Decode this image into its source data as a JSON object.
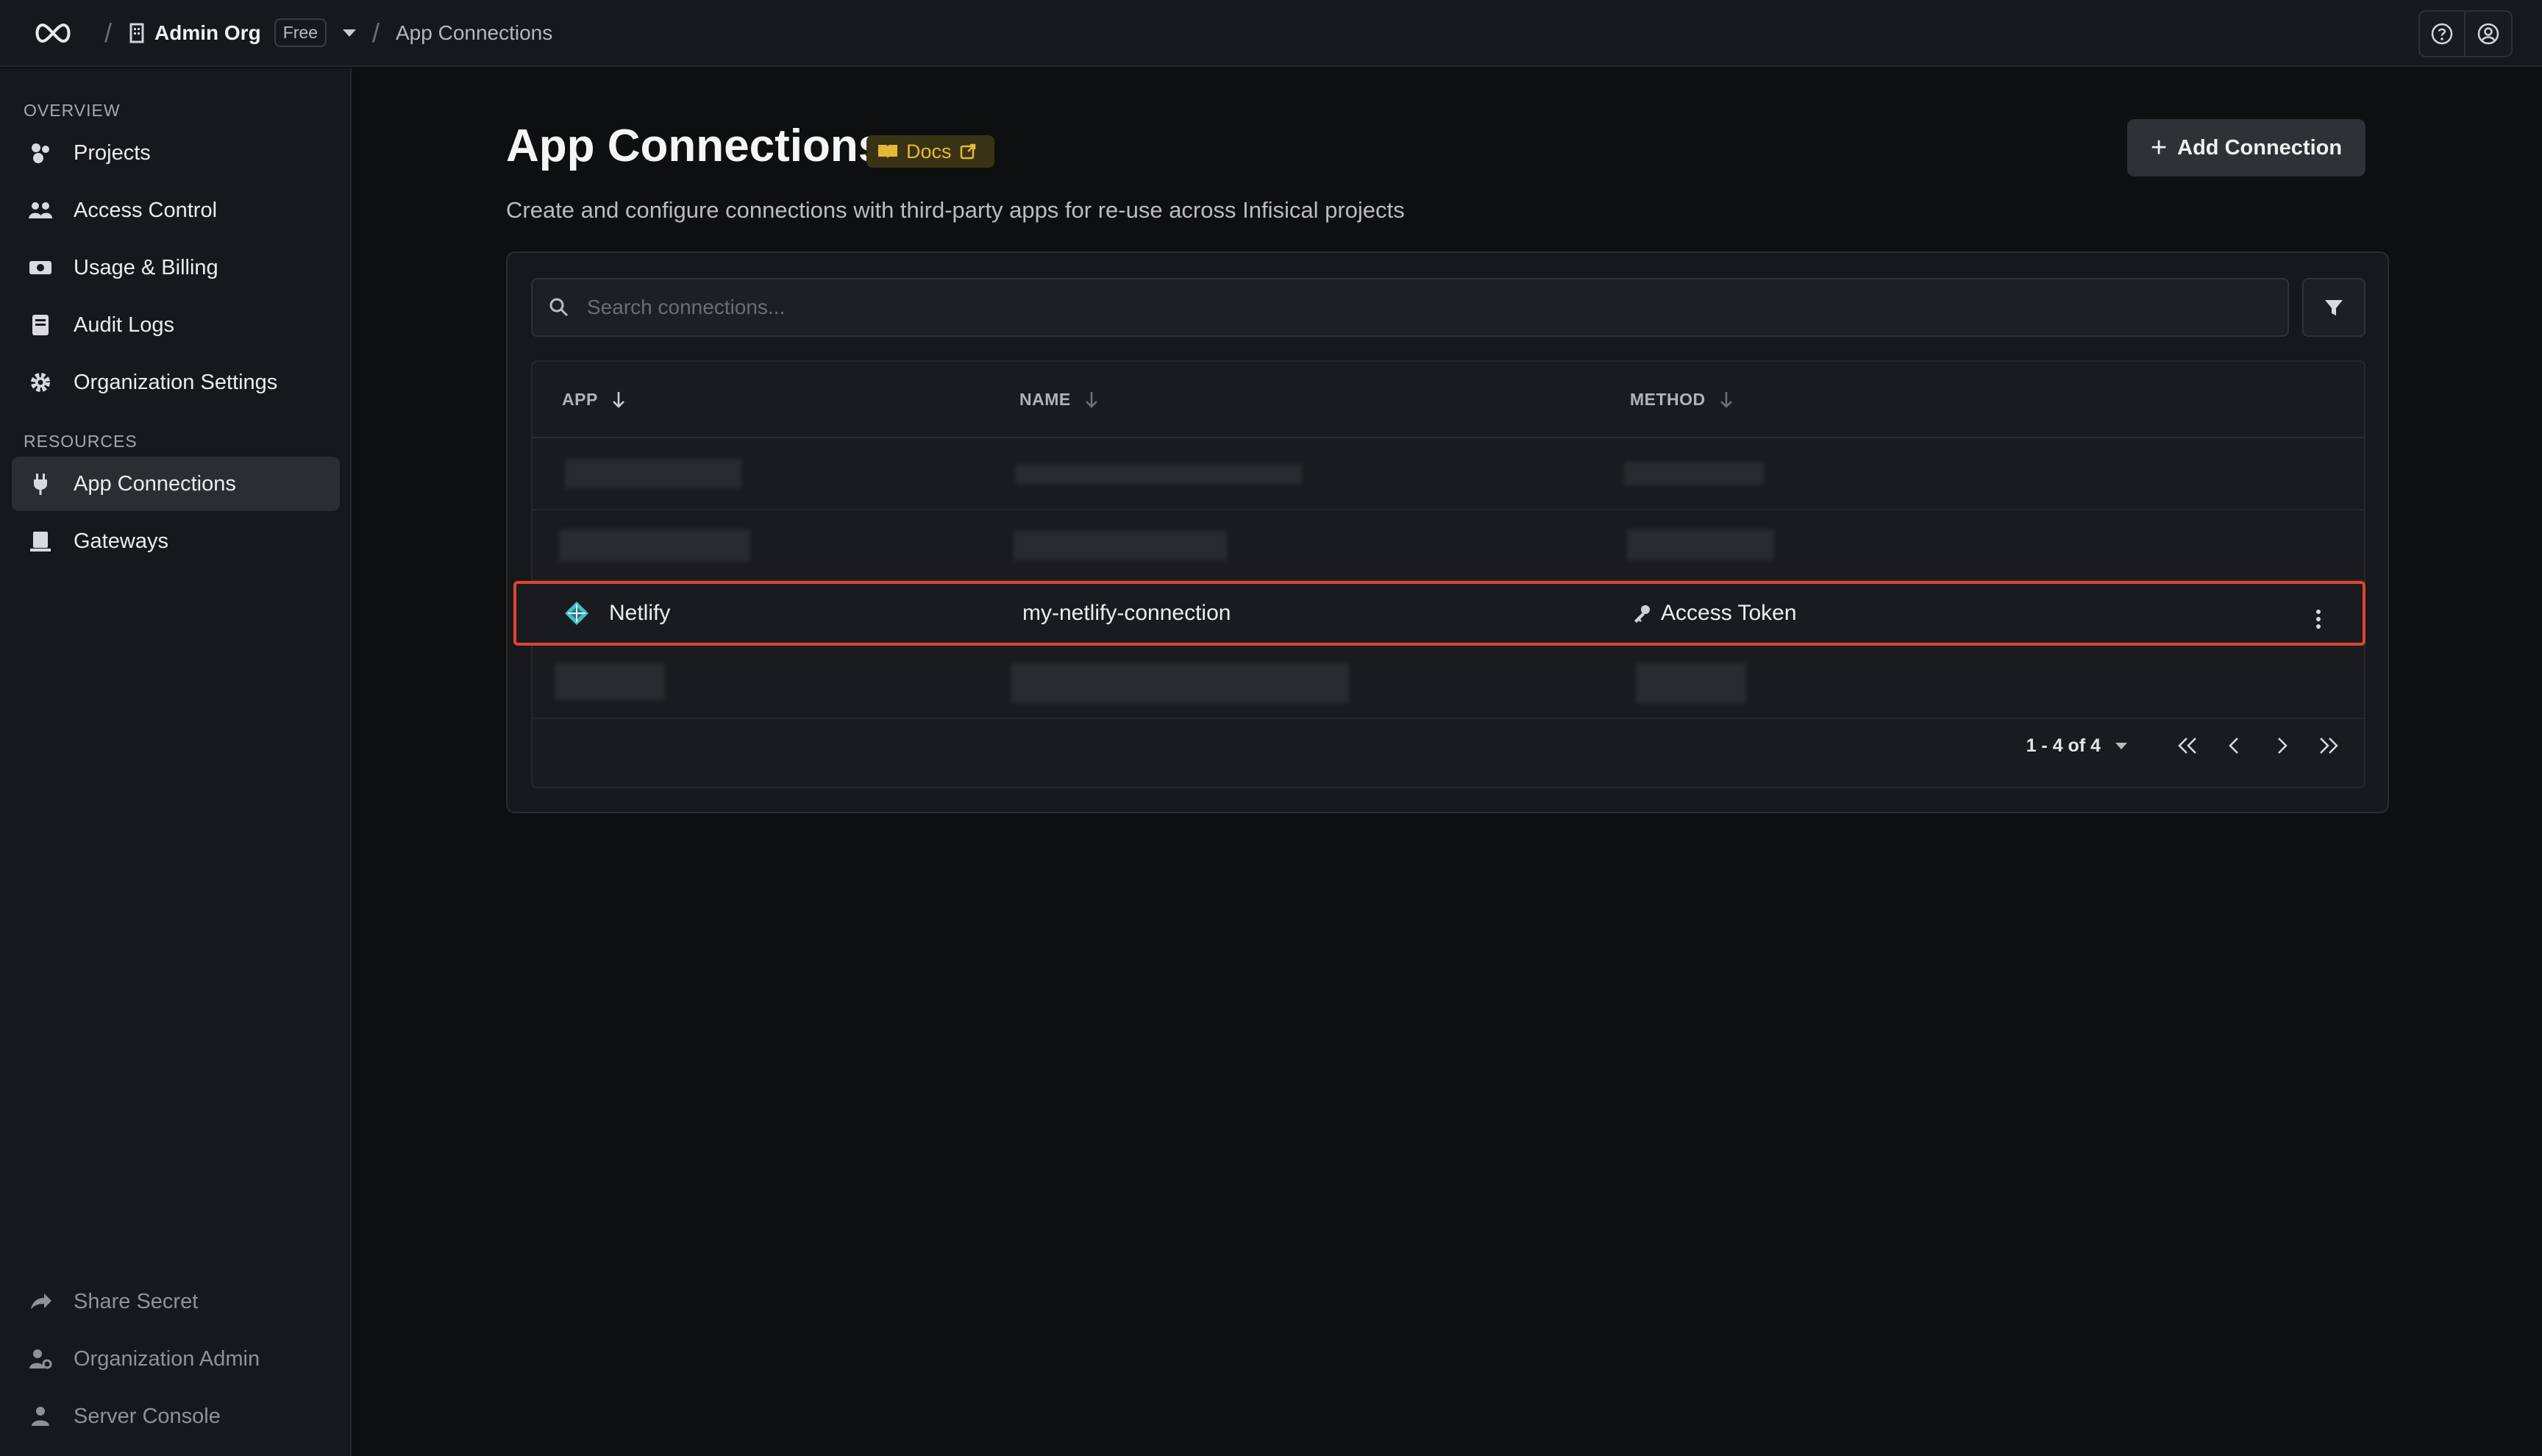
{
  "header": {
    "org_name": "Admin Org",
    "plan_badge": "Free",
    "current_page": "App Connections"
  },
  "sidebar": {
    "overview_label": "OVERVIEW",
    "resources_label": "RESOURCES",
    "items": [
      {
        "label": "Projects",
        "icon": "projects-icon"
      },
      {
        "label": "Access Control",
        "icon": "users-icon"
      },
      {
        "label": "Usage & Billing",
        "icon": "billing-icon"
      },
      {
        "label": "Audit Logs",
        "icon": "audit-log-icon"
      },
      {
        "label": "Organization Settings",
        "icon": "gear-icon"
      },
      {
        "label": "App Connections",
        "icon": "plug-icon",
        "active": true
      },
      {
        "label": "Gateways",
        "icon": "gateway-icon"
      }
    ],
    "footer_items": [
      {
        "label": "Share Secret",
        "icon": "share-icon"
      },
      {
        "label": "Organization Admin",
        "icon": "user-cog-icon"
      },
      {
        "label": "Server Console",
        "icon": "user-shield-icon"
      }
    ]
  },
  "main": {
    "title": "App Connections",
    "docs_label": "Docs",
    "subtitle": "Create and configure connections with third-party apps for re-use across Infisical projects",
    "add_button": "Add Connection",
    "search_placeholder": "Search connections..."
  },
  "table": {
    "columns": [
      "APP",
      "NAME",
      "METHOD"
    ],
    "visible_row": {
      "app": "Netlify",
      "name": "my-netlify-connection",
      "method": "Access Token"
    },
    "pagination": "1 - 4 of 4"
  },
  "colors": {
    "accent_highlight": "#e0442f",
    "docs_badge": "#e5b935",
    "netlify": "#3fc1c9"
  }
}
